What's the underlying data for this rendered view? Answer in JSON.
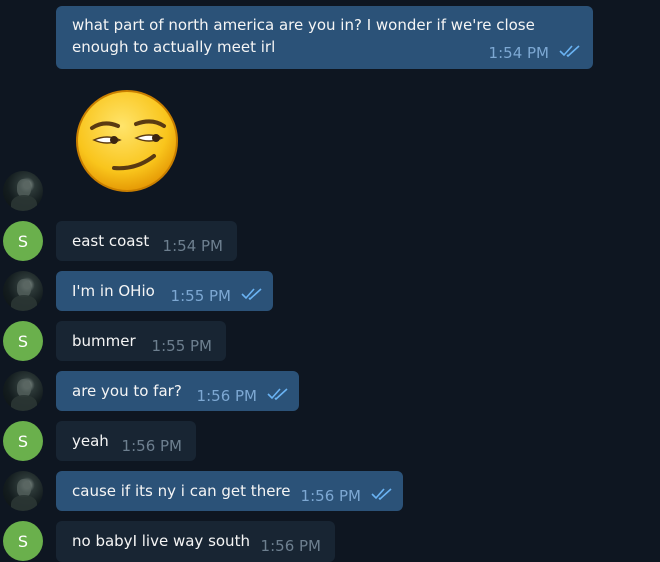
{
  "messages": [
    {
      "text_line1": "what part of north america are you in? I wonder if we're close",
      "text_line2": "enough to actually meet irl",
      "time": "1:54 PM"
    },
    {
      "text": "east coast",
      "time": "1:54 PM"
    },
    {
      "text": "I'm in OHio",
      "time": "1:55 PM"
    },
    {
      "text": "bummer",
      "time": "1:55 PM"
    },
    {
      "text": "are you to far?",
      "time": "1:56 PM"
    },
    {
      "text": "yeah",
      "time": "1:56 PM"
    },
    {
      "text": "cause if its ny i can get there",
      "time": "1:56 PM"
    },
    {
      "text": "no babyI live way south",
      "time": "1:56 PM"
    }
  ],
  "contact_initial": "S",
  "sticker": {
    "icon": "smirking-face-icon"
  },
  "colors": {
    "background": "#0e1621",
    "incoming": "#182533",
    "outgoing": "#2b5278",
    "avatar_letter": "#6ab04c"
  }
}
